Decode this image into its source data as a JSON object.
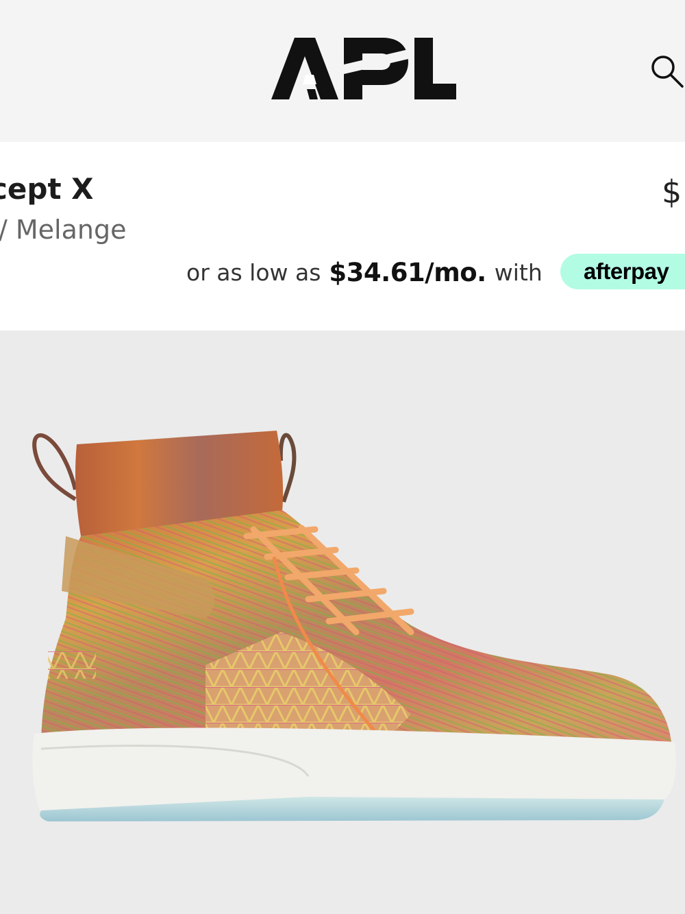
{
  "header": {
    "logo_text": "APL",
    "search_icon": "search-icon"
  },
  "product": {
    "name": "cept X",
    "color": "/ Melange",
    "price": "$"
  },
  "payment": {
    "prefix": "or as low as",
    "amount": "$34.61/mo.",
    "with": "with",
    "provider": "afterpay"
  },
  "colors": {
    "header_bg": "#f4f4f4",
    "afterpay_mint": "#b2fce4",
    "image_bg": "#ebebeb"
  }
}
